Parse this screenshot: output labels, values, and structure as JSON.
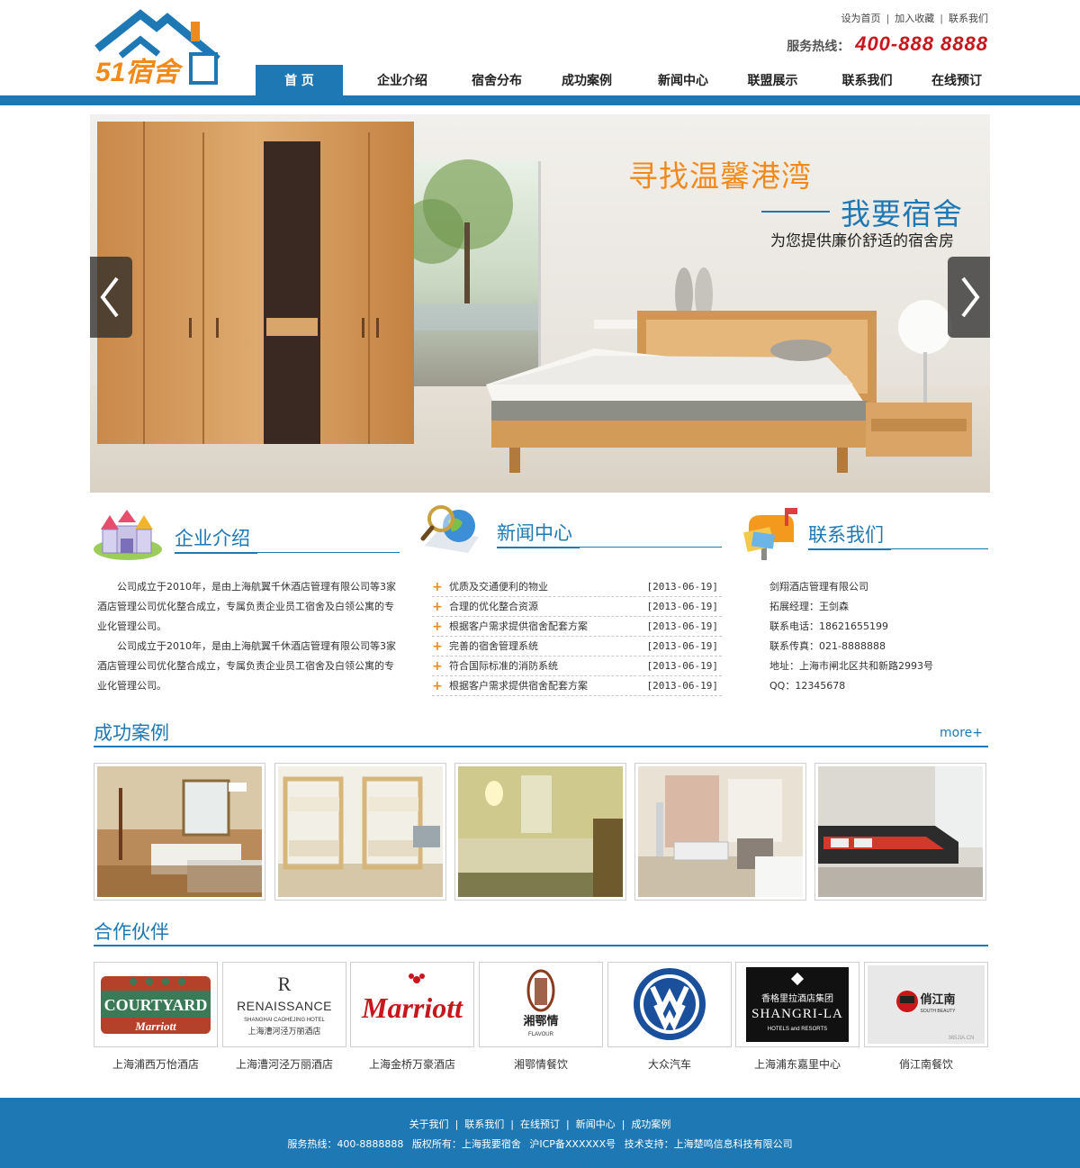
{
  "site": {
    "logo_text": "51宿舍",
    "top_links": [
      "设为首页",
      "加入收藏",
      "联系我们"
    ],
    "hotline_label": "服务热线：",
    "hotline_number": "400-888 8888"
  },
  "nav": [
    {
      "label": "首 页",
      "active": true
    },
    {
      "label": "企业介绍",
      "active": false
    },
    {
      "label": "宿舍分布",
      "active": false
    },
    {
      "label": "成功案例",
      "active": false
    },
    {
      "label": "新闻中心",
      "active": false
    },
    {
      "label": "联盟展示",
      "active": false
    },
    {
      "label": "联系我们",
      "active": false
    },
    {
      "label": "在线预订",
      "active": false
    }
  ],
  "banner": {
    "line1": "寻找温馨港湾",
    "line2": "我要宿舍",
    "line3": "为您提供廉价舒适的宿舍房"
  },
  "about": {
    "title": "企业介绍",
    "paragraphs": [
      "公司成立于2010年，是由上海航翼千休酒店管理有限公司等3家酒店管理公司优化整合成立，专属负责企业员工宿舍及白领公寓的专业化管理公司。",
      "公司成立于2010年，是由上海航翼千休酒店管理有限公司等3家酒店管理公司优化整合成立，专属负责企业员工宿舍及白领公寓的专业化管理公司。"
    ]
  },
  "news": {
    "title": "新闻中心",
    "items": [
      {
        "title": "优质及交通便利的物业",
        "date": "[2013-06-19]"
      },
      {
        "title": "合理的优化整合资源",
        "date": "[2013-06-19]"
      },
      {
        "title": "根据客户需求提供宿舍配套方案",
        "date": "[2013-06-19]"
      },
      {
        "title": "完善的宿舍管理系统",
        "date": "[2013-06-19]"
      },
      {
        "title": "符合国际标准的消防系统",
        "date": "[2013-06-19]"
      },
      {
        "title": "根据客户需求提供宿舍配套方案",
        "date": "[2013-06-19]"
      }
    ]
  },
  "contact": {
    "title": "联系我们",
    "lines": [
      "剑翔酒店管理有限公司",
      "拓展经理：王剑森",
      "联系电话：18621655199",
      "联系传真：021-8888888",
      "地址：上海市闸北区共和新路2993号",
      "QQ：12345678"
    ]
  },
  "cases": {
    "title": "成功案例",
    "more": "more+"
  },
  "partners": {
    "title": "合作伙伴",
    "items": [
      {
        "name": "上海浦西万怡酒店",
        "logo": "COURTYARD",
        "logo_sub": "Marriott"
      },
      {
        "name": "上海漕河泾万丽酒店",
        "logo": "RENAISSANCE",
        "logo_sub": "SHANGHAI CAOHEJING HOTEL",
        "logo_sub2": "上海漕河泾万丽酒店",
        "logo_letter": "R"
      },
      {
        "name": "上海金桥万豪酒店",
        "logo": "Marriott"
      },
      {
        "name": "湘鄂情餐饮",
        "logo": "湘鄂情",
        "logo_sub": "FLAVOUR"
      },
      {
        "name": "大众汽车",
        "logo": "VW"
      },
      {
        "name": "上海浦东嘉里中心",
        "logo": "SHANGRI-LA",
        "logo_cn": "香格里拉酒店集团",
        "logo_sub": "HOTELS and RESORTS"
      },
      {
        "name": "俏江南餐饮",
        "logo": "俏江南",
        "logo_sub": "SOUTH BEAUTY",
        "logo_wm": "365JIA.CN"
      }
    ]
  },
  "footer": {
    "links": [
      "关于我们",
      "联系我们",
      "在线预订",
      "新闻中心",
      "成功案例"
    ],
    "hotline": "服务热线：400-8888888",
    "copyright": "版权所有：上海我要宿舍",
    "icp": "沪ICP备XXXXXX号",
    "support": "技术支持：上海楚鸣信息科技有限公司"
  },
  "colors": {
    "brand_blue": "#1e78b4",
    "accent_orange": "#f08a1c",
    "hotline_red": "#c8161d"
  }
}
